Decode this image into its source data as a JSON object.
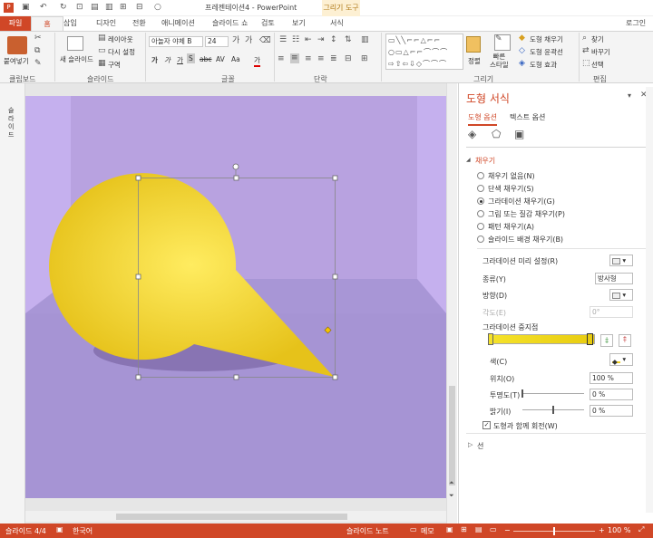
{
  "title": {
    "text": "프레젠테이션4 - PowerPoint",
    "context_group": "그리기 도구",
    "login": "로그인"
  },
  "tabs": {
    "file": "파일",
    "home": "홈",
    "insert": "삽입",
    "design": "디자인",
    "transitions": "전환",
    "animations": "애니메이션",
    "slideshow": "슬라이드 쇼",
    "review": "검토",
    "view": "보기",
    "format": "서식"
  },
  "ribbon": {
    "clipboard": {
      "label": "클립보드",
      "paste": "붙여넣기"
    },
    "slides": {
      "label": "슬라이드",
      "new_slide": "새 슬라이드",
      "layout": "레이아웃",
      "reset": "다시 설정",
      "section": "구역"
    },
    "font": {
      "label": "글꼴",
      "font_name": "아놀자 야체 B",
      "font_size": "24",
      "bold": "가",
      "italic": "가",
      "underline": "가",
      "shadow": "S",
      "strike": "abc",
      "spacing": "AV",
      "case": "Aa",
      "color": "가"
    },
    "paragraph": {
      "label": "단락"
    },
    "drawing": {
      "label": "그리기",
      "arrange": "정렬",
      "quick_styles": "빠른\n스타일",
      "fill": "도형 채우기",
      "outline": "도형 윤곽선",
      "effects": "도형 효과"
    },
    "editing": {
      "label": "편집",
      "find": "찾기",
      "replace": "바꾸기",
      "select": "선택"
    }
  },
  "left_panel": {
    "label": "슬\n라\n이\n드"
  },
  "format_pane": {
    "title": "도형 서식",
    "tab_shape": "도형 옵션",
    "tab_text": "텍스트 옵션",
    "fill_header": "채우기",
    "fill_options": [
      "채우기 없음(N)",
      "단색 채우기(S)",
      "그라데이션 채우기(G)",
      "그림 또는 질감 채우기(P)",
      "패턴 채우기(A)",
      "슬라이드 배경 채우기(B)"
    ],
    "selected_fill": 2,
    "preset_label": "그라데이션 미리 설정(R)",
    "type_label": "종류(Y)",
    "type_value": "방사형",
    "direction_label": "방향(D)",
    "angle_label": "각도(E)",
    "angle_value": "0°",
    "stops_label": "그라데이션 중지점",
    "color_label": "색(C)",
    "position_label": "위치(O)",
    "position_value": "100 %",
    "transparency_label": "투명도(T)",
    "transparency_value": "0 %",
    "brightness_label": "밝기(I)",
    "brightness_value": "0 %",
    "rotate_label": "도형과 함께 회전(W)",
    "line_header": "선"
  },
  "status": {
    "slide": "슬라이드 4/4",
    "language": "한국어",
    "notes": "슬라이드 노트",
    "comments": "메모",
    "zoom": "100 %"
  },
  "colors": {
    "accent": "#d04727",
    "slide_bg": "#b8a2e0",
    "bubble": "#f2d43d",
    "gradient_end": "#e6c21a"
  }
}
